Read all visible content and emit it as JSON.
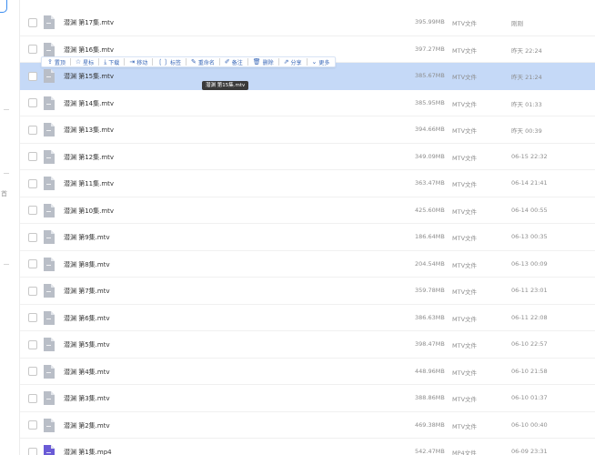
{
  "files": [
    {
      "name": "潜渊 第17集.mtv",
      "size": "395.99MB",
      "type": "MTV文件",
      "date": "刚刚",
      "icon": "generic-file-icon"
    },
    {
      "name": "潜渊 第16集.mtv",
      "size": "397.27MB",
      "type": "MTV文件",
      "date": "昨天 22:24",
      "icon": "generic-file-icon"
    },
    {
      "name": "潜渊 第15集.mtv",
      "size": "385.67MB",
      "type": "MTV文件",
      "date": "昨天 21:24",
      "icon": "generic-file-icon",
      "selected": true
    },
    {
      "name": "潜渊 第14集.mtv",
      "size": "385.95MB",
      "type": "MTV文件",
      "date": "昨天 01:33",
      "icon": "generic-file-icon"
    },
    {
      "name": "潜渊 第13集.mtv",
      "size": "394.66MB",
      "type": "MTV文件",
      "date": "昨天 00:39",
      "icon": "generic-file-icon"
    },
    {
      "name": "潜渊 第12集.mtv",
      "size": "349.09MB",
      "type": "MTV文件",
      "date": "06-15 22:32",
      "icon": "generic-file-icon"
    },
    {
      "name": "潜渊 第11集.mtv",
      "size": "363.47MB",
      "type": "MTV文件",
      "date": "06-14 21:41",
      "icon": "generic-file-icon"
    },
    {
      "name": "潜渊 第10集.mtv",
      "size": "425.60MB",
      "type": "MTV文件",
      "date": "06-14 00:55",
      "icon": "generic-file-icon"
    },
    {
      "name": "潜渊 第9集.mtv",
      "size": "186.64MB",
      "type": "MTV文件",
      "date": "06-13 00:35",
      "icon": "generic-file-icon"
    },
    {
      "name": "潜渊 第8集.mtv",
      "size": "204.54MB",
      "type": "MTV文件",
      "date": "06-13 00:09",
      "icon": "generic-file-icon"
    },
    {
      "name": "潜渊 第7集.mtv",
      "size": "359.78MB",
      "type": "MTV文件",
      "date": "06-11 23:01",
      "icon": "generic-file-icon"
    },
    {
      "name": "潜渊 第6集.mtv",
      "size": "386.63MB",
      "type": "MTV文件",
      "date": "06-11 22:08",
      "icon": "generic-file-icon"
    },
    {
      "name": "潜渊 第5集.mtv",
      "size": "398.47MB",
      "type": "MTV文件",
      "date": "06-10 22:57",
      "icon": "generic-file-icon"
    },
    {
      "name": "潜渊 第4集.mtv",
      "size": "448.96MB",
      "type": "MTV文件",
      "date": "06-10 21:58",
      "icon": "generic-file-icon"
    },
    {
      "name": "潜渊 第3集.mtv",
      "size": "388.86MB",
      "type": "MTV文件",
      "date": "06-10 01:37",
      "icon": "generic-file-icon"
    },
    {
      "name": "潜渊 第2集.mtv",
      "size": "469.38MB",
      "type": "MTV文件",
      "date": "06-10 00:40",
      "icon": "generic-file-icon"
    },
    {
      "name": "潜渊 第1集.mp4",
      "size": "542.47MB",
      "type": "MP4文件",
      "date": "06-09 23:31",
      "icon": "video-file-icon"
    }
  ],
  "toolbar": [
    {
      "label": "置顶",
      "icon": "pin-top-icon",
      "glyph": "⇪"
    },
    {
      "label": "星标",
      "icon": "star-icon",
      "glyph": "☆"
    },
    {
      "label": "下载",
      "icon": "download-icon",
      "glyph": "⤓"
    },
    {
      "label": "移动",
      "icon": "move-icon",
      "glyph": "⇥"
    },
    {
      "label": "标签",
      "icon": "tag-icon",
      "glyph": "❲❳"
    },
    {
      "label": "重命名",
      "icon": "rename-icon",
      "glyph": "✎"
    },
    {
      "label": "备注",
      "icon": "note-icon",
      "glyph": "✐"
    },
    {
      "label": "删除",
      "icon": "delete-icon",
      "glyph": "🗑"
    },
    {
      "label": "分享",
      "icon": "share-icon",
      "glyph": "⇗"
    },
    {
      "label": "更多",
      "icon": "chevron-down-icon",
      "glyph": "⌄"
    }
  ],
  "tooltip": "潜渊 第15集.mtv",
  "sidebar_glyph": "首",
  "colors": {
    "selected_row": "#c5d9f7",
    "accent": "#3a68b8",
    "file_icon": "#b9bec7",
    "video_icon": "#6a5bd6"
  }
}
